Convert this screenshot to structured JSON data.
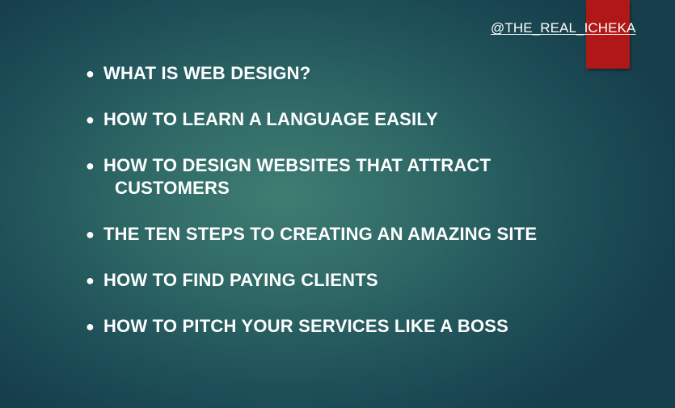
{
  "slide": {
    "handle": "@THE_REAL_ICHEKA",
    "bullet_glyph": "●",
    "items": [
      {
        "text": "WHAT IS WEB DESIGN?"
      },
      {
        "text": "HOW TO LEARN A LANGUAGE EASILY"
      },
      {
        "line1": "HOW TO DESIGN WEBSITES THAT ATTRACT",
        "line2": "CUSTOMERS"
      },
      {
        "text": "THE TEN STEPS TO CREATING AN AMAZING SITE"
      },
      {
        "text": "HOW TO FIND PAYING CLIENTS"
      },
      {
        "text": "HOW TO PITCH YOUR SERVICES LIKE A BOSS"
      }
    ]
  },
  "colors": {
    "background_center": "#3f7d72",
    "background_edge": "#163f4b",
    "accent_red": "#b01818",
    "text": "#ffffff"
  }
}
